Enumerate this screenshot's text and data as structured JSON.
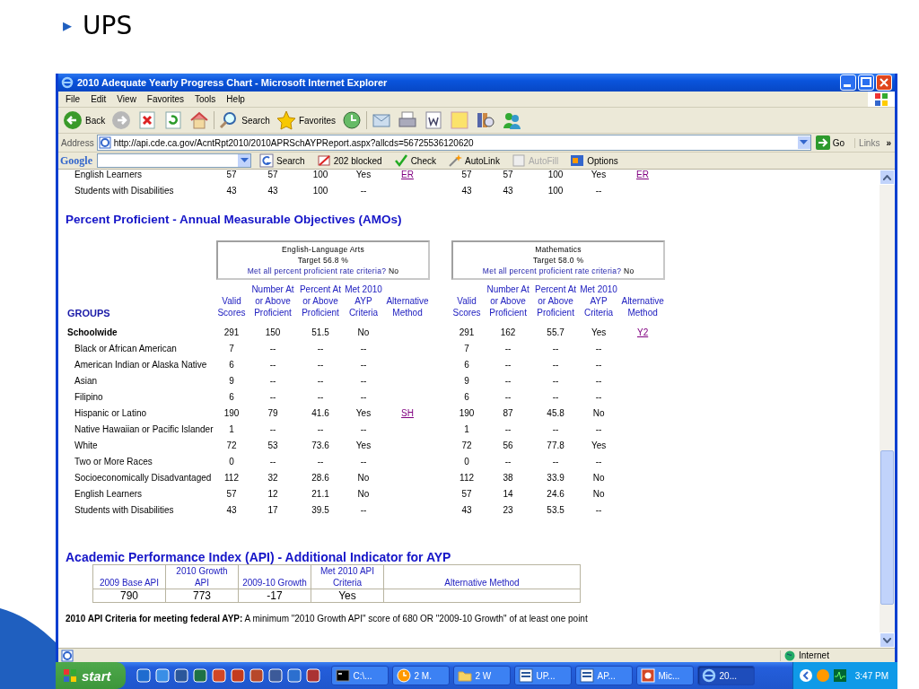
{
  "slide": {
    "bullet": "▸",
    "title": "UPS"
  },
  "window": {
    "title": "2010 Adequate Yearly Progress Chart - Microsoft Internet Explorer"
  },
  "menu": [
    "File",
    "Edit",
    "View",
    "Favorites",
    "Tools",
    "Help"
  ],
  "toolbar": [
    {
      "kind": "back",
      "label": "Back"
    },
    {
      "kind": "forward"
    },
    {
      "kind": "stop"
    },
    {
      "kind": "refresh"
    },
    {
      "kind": "home"
    },
    {
      "kind": "search",
      "label": "Search"
    },
    {
      "kind": "favorites",
      "label": "Favorites"
    },
    {
      "kind": "history"
    },
    {
      "kind": "mail"
    },
    {
      "kind": "print"
    },
    {
      "kind": "word"
    },
    {
      "kind": "note"
    },
    {
      "kind": "research"
    },
    {
      "kind": "messenger"
    }
  ],
  "address": {
    "label": "Address",
    "value": "http://api.cde.ca.gov/AcntRpt2010/2010APRSchAYPReport.aspx?allcds=56725536120620",
    "go": "Go",
    "links": "Links",
    "more": "»"
  },
  "google_toolbar": {
    "logo": "Google",
    "items": [
      {
        "kind": "search",
        "label": "Search",
        "disabled": false
      },
      {
        "kind": "blocker",
        "label": "202 blocked",
        "disabled": false
      },
      {
        "kind": "check",
        "label": "Check",
        "disabled": false
      },
      {
        "kind": "autolink",
        "label": "AutoLink",
        "disabled": false
      },
      {
        "kind": "autofill",
        "label": "AutoFill",
        "disabled": true
      },
      {
        "kind": "options",
        "label": "Options",
        "disabled": false
      }
    ]
  },
  "content": {
    "previous_rows": [
      {
        "group": "English Learners",
        "ela": [
          "57",
          "57",
          "100",
          "Yes"
        ],
        "ela_alt": "ER",
        "math": [
          "57",
          "57",
          "100",
          "Yes"
        ],
        "math_alt": "ER"
      },
      {
        "group": "Students with Disabilities",
        "ela": [
          "43",
          "43",
          "100",
          "--"
        ],
        "math": [
          "43",
          "43",
          "100",
          "--"
        ]
      }
    ],
    "amo": {
      "title": "Percent Proficient - Annual Measurable Objectives (AMOs)",
      "ela_box": {
        "subject": "English-Language Arts",
        "target": "Target 56.8 %",
        "question": "Met all percent proficient rate criteria?",
        "answer": "No"
      },
      "math_box": {
        "subject": "Mathematics",
        "target": "Target 58.0 %",
        "question": "Met all percent proficient rate criteria?",
        "answer": "No"
      },
      "groups_label": "GROUPS",
      "ela_columns": [
        "Valid Scores",
        "Number At or Above Proficient",
        "Percent At or Above Proficient",
        "Met 2010 AYP Criteria",
        "Alternative Method"
      ],
      "math_columns": [
        "Valid Scores",
        "Number At or Above Proficient",
        "Percent At or Above Proficient",
        "Met 2010 AYP Criteria",
        "Alternative Method"
      ],
      "rows": [
        {
          "kind": "total",
          "group": "Schoolwide",
          "ela": [
            "291",
            "150",
            "51.5",
            "No"
          ],
          "math": [
            "291",
            "162",
            "55.7",
            "Yes"
          ],
          "math_alt": "Y2"
        },
        {
          "kind": "subgroup",
          "group": "Black or African American",
          "ela": [
            "7",
            "--",
            "--",
            "--"
          ],
          "math": [
            "7",
            "--",
            "--",
            "--"
          ]
        },
        {
          "kind": "subgroup",
          "group": "American Indian or Alaska Native",
          "ela": [
            "6",
            "--",
            "--",
            "--"
          ],
          "math": [
            "6",
            "--",
            "--",
            "--"
          ]
        },
        {
          "kind": "subgroup",
          "group": "Asian",
          "ela": [
            "9",
            "--",
            "--",
            "--"
          ],
          "math": [
            "9",
            "--",
            "--",
            "--"
          ]
        },
        {
          "kind": "subgroup",
          "group": "Filipino",
          "ela": [
            "6",
            "--",
            "--",
            "--"
          ],
          "math": [
            "6",
            "--",
            "--",
            "--"
          ]
        },
        {
          "kind": "subgroup",
          "group": "Hispanic or Latino",
          "ela": [
            "190",
            "79",
            "41.6",
            "Yes"
          ],
          "ela_alt": "SH",
          "math": [
            "190",
            "87",
            "45.8",
            "No"
          ]
        },
        {
          "kind": "subgroup",
          "group": "Native Hawaiian or Pacific Islander",
          "ela": [
            "1",
            "--",
            "--",
            "--"
          ],
          "math": [
            "1",
            "--",
            "--",
            "--"
          ]
        },
        {
          "kind": "subgroup",
          "group": "White",
          "ela": [
            "72",
            "53",
            "73.6",
            "Yes"
          ],
          "math": [
            "72",
            "56",
            "77.8",
            "Yes"
          ]
        },
        {
          "kind": "subgroup",
          "group": "Two or More Races",
          "ela": [
            "0",
            "--",
            "--",
            "--"
          ],
          "math": [
            "0",
            "--",
            "--",
            "--"
          ]
        },
        {
          "kind": "subgroup",
          "group": "Socioeconomically Disadvantaged",
          "ela": [
            "112",
            "32",
            "28.6",
            "No"
          ],
          "math": [
            "112",
            "38",
            "33.9",
            "No"
          ]
        },
        {
          "kind": "subgroup",
          "group": "English Learners",
          "ela": [
            "57",
            "12",
            "21.1",
            "No"
          ],
          "math": [
            "57",
            "14",
            "24.6",
            "No"
          ]
        },
        {
          "kind": "subgroup",
          "group": "Students with Disabilities",
          "ela": [
            "43",
            "17",
            "39.5",
            "--"
          ],
          "math": [
            "43",
            "23",
            "53.5",
            "--"
          ]
        }
      ]
    },
    "api": {
      "title": "Academic Performance Index (API) - Additional Indicator for AYP",
      "columns": [
        "2009 Base API",
        "2010 Growth API",
        "2009-10 Growth",
        "Met 2010 API Criteria",
        "Alternative Method"
      ],
      "values": [
        "790",
        "773",
        "-17",
        "Yes"
      ]
    },
    "footnote": "**2010 API Criteria for meeting federal AYP:** A minimum \"2010 Growth API\" score of 680 OR \"2009-10 Growth\" of at least one point"
  },
  "status_bar": {
    "zone": "Internet"
  },
  "taskbar": {
    "start": "start",
    "tasks": [
      {
        "kind": "console",
        "label": "C:\\...",
        "selected": false
      },
      {
        "kind": "clock",
        "label": "2 M.",
        "selected": false
      },
      {
        "kind": "folder",
        "label": "2 W",
        "selected": false
      },
      {
        "kind": "word",
        "label": "UP...",
        "selected": false
      },
      {
        "kind": "word",
        "label": "AP...",
        "selected": false
      },
      {
        "kind": "slides",
        "label": "Mic...",
        "selected": false
      },
      {
        "kind": "browser",
        "label": "20...",
        "selected": true
      }
    ],
    "clock": "3:47 PM"
  }
}
